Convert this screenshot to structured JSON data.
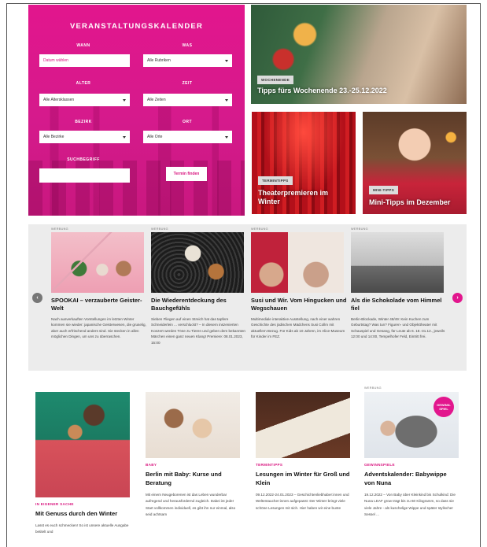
{
  "calendar": {
    "title": "VERANSTALTUNGSKALENDER",
    "labels": {
      "wann": "WANN",
      "was": "WAS",
      "alter": "ALTER",
      "zeit": "ZEIT",
      "bezirk": "BEZIRK",
      "ort": "ORT",
      "suchbegriff": "SUCHBEGRIFF"
    },
    "date_placeholder": "Datum wählen",
    "rubrik": "Alle Rubriken",
    "alter": "Alle Altersklassen",
    "zeit": "Alle Zeiten",
    "bezirk": "Alle Bezirke",
    "ort": "Alle Orte",
    "search_value": "",
    "search_button": "Termin finden",
    "accent": "#e2168d"
  },
  "tiles": {
    "weekend": {
      "tag": "WOCHENENDE",
      "caption": "Tipps fürs Wochenende 23.-25.12.2022"
    },
    "theater": {
      "tag": "TERMINTIPPS",
      "caption": "Theaterpremieren im Winter"
    },
    "mini": {
      "tag": "MINI-TIPPS",
      "caption": "Mini-Tipps im Dezember"
    }
  },
  "carousel": {
    "cards": [
      {
        "werbung": "WERBUNG",
        "title": "SPOOKAI – verzauberte Geister-Welt",
        "text": "Nach ausverkauften Vorstellungen im letzten Winter kommen sie wieder: japanische Geisterwesen, die gruselig, aber auch erfrischend anders sind. Sie stecken in allen möglichen Dingen, um uns zu überraschen."
      },
      {
        "werbung": "WERBUNG",
        "title": "Die Wiederentdeckung des Bauchgefühls",
        "text": "Sieben Fliegen auf einen Streich hat das tapfere Schneiderlein ... verschluckt? – In diesem inszenierten Konzert werden Töne zu Tieren und geben dem bekannten Märchen einen ganz neuen Klang! Premiere: 08.01.2023, 15:00"
      },
      {
        "werbung": "WERBUNG",
        "title": "Susi und Wir. Vom Hingucken und Wegschauen",
        "text": "Multimediale interaktive Ausstellung, nach einer wahren Geschichte des jüdischen Mädchens Susi Collm mit aktuellem Bezug. Für Kids ab 10 Jahren, im Alice-Museum für Kinder im FEZ."
      },
      {
        "werbung": "WERBUNG",
        "title": "Als die Schokolade vom Himmel fiel",
        "text": "Berlin-Blockade, Winter 48/49: Kein Kuchen zum Geburtstag? Was tun? Figuren- und Objekttheater mit Schauspiel und Gesang, für Leute ab 6. 18.-31.12., jeweils 12:00 und 14:00, Tempelhofer Feld, Eintritt frei."
      }
    ],
    "prev": "‹",
    "next": "›"
  },
  "bottom": {
    "cards": [
      {
        "werbung": "",
        "category": "IN EIGENER SACHE",
        "title": "Mit Genuss durch den Winter",
        "text": "Lasst es euch schmecken! So ist unsere aktuelle Ausgabe betitelt und"
      },
      {
        "werbung": "",
        "category": "BABY",
        "title": "Berlin mit Baby: Kurse und Beratung",
        "text": "Mit einem Neugeborenen ist das Leben wunderbar aufregend und herausfordernd zugleich. Dabei ist jeder Start vollkommen individuell, es gibt ihn nur einmal, also seid achtsam"
      },
      {
        "werbung": "",
        "category": "TERMINTIPPS",
        "title": "Lesungen im Winter für Groß und Klein",
        "text": "09.12.2022-24.01.2023 – Geschichtenliebhaber:innen und Weltentaucher:innen aufgepasst: Der Winter bringt viele schöne Lesungen mit sich. Hier haben wir eine bunte"
      },
      {
        "werbung": "WERBUNG",
        "category": "GEWINNSPIELE",
        "title": "Adventskalender: Babywippe von Nuna",
        "text": "19.12.2022 – Von Baby über Kleinkind bis Schulkind: Die Nuna LEAF grow trägt bis zu 60 Kilogramm, so dass sie viele Jahre - als kuschelige Wippe und später stylischer Sessel ...",
        "badge": "GEWINN-SPIEL"
      }
    ]
  }
}
